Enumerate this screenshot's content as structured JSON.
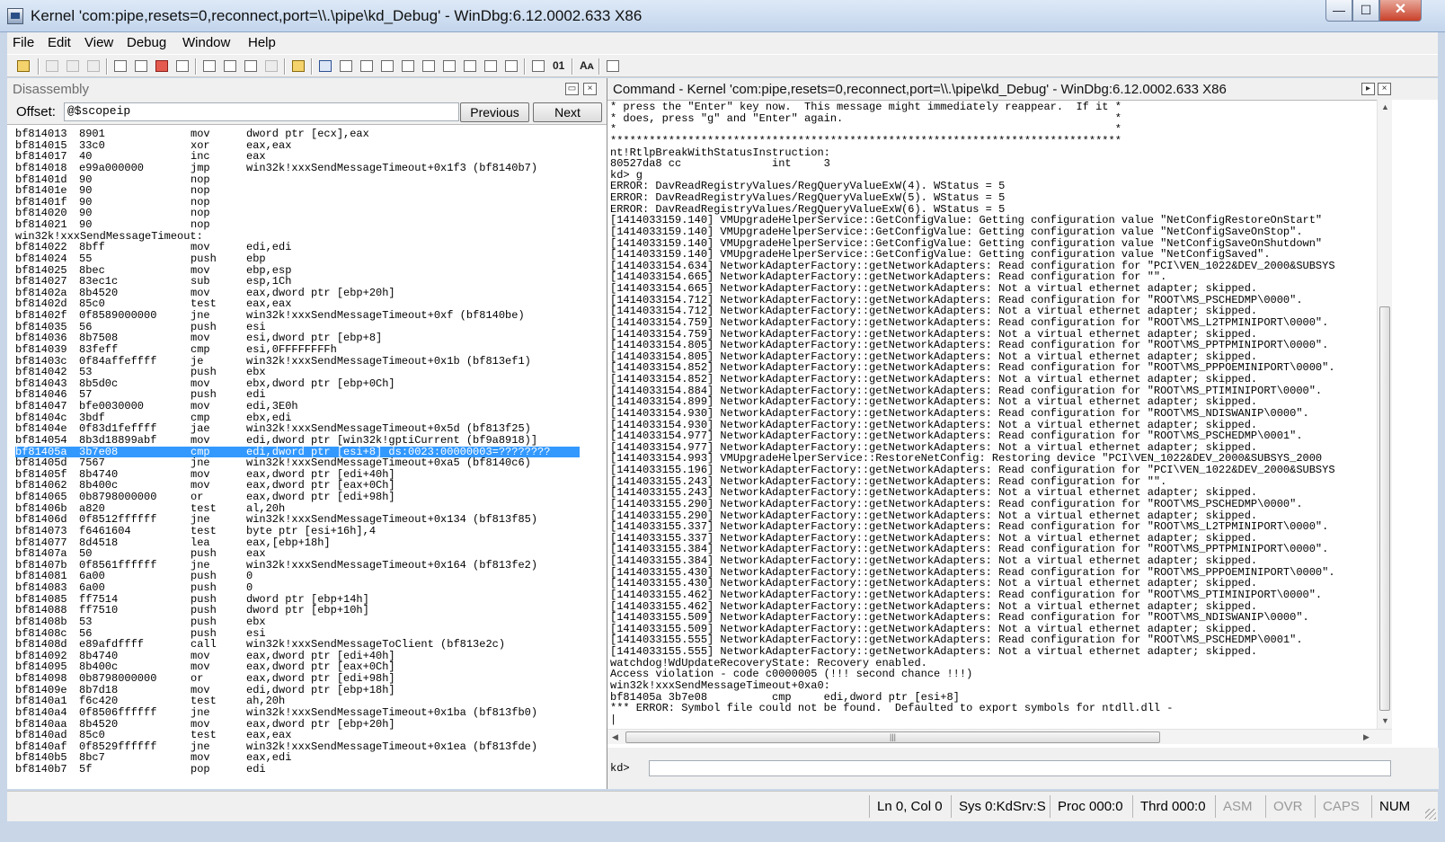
{
  "window": {
    "title": "Kernel 'com:pipe,resets=0,reconnect,port=\\\\.\\pipe\\kd_Debug' - WinDbg:6.12.0002.633 X86",
    "minimize": "—",
    "maximize": "☐",
    "close": "✕"
  },
  "menu": [
    "File",
    "Edit",
    "View",
    "Debug",
    "Window",
    "Help"
  ],
  "disassembly": {
    "title": "Disassembly",
    "offset_label": "Offset:",
    "offset_value": "@$scopeip",
    "prev_label": "Previous",
    "next_label": "Next",
    "rows": [
      [
        "bf814013",
        "8901",
        "mov",
        "dword ptr [ecx],eax"
      ],
      [
        "bf814015",
        "33c0",
        "xor",
        "eax,eax"
      ],
      [
        "bf814017",
        "40",
        "inc",
        "eax"
      ],
      [
        "bf814018",
        "e99a000000",
        "jmp",
        "win32k!xxxSendMessageTimeout+0x1f3 (bf8140b7)"
      ],
      [
        "bf81401d",
        "90",
        "nop",
        ""
      ],
      [
        "bf81401e",
        "90",
        "nop",
        ""
      ],
      [
        "bf81401f",
        "90",
        "nop",
        ""
      ],
      [
        "bf814020",
        "90",
        "nop",
        ""
      ],
      [
        "bf814021",
        "90",
        "nop",
        ""
      ],
      [
        "win32k!xxxSendMessageTimeout:"
      ],
      [
        "bf814022",
        "8bff",
        "mov",
        "edi,edi"
      ],
      [
        "bf814024",
        "55",
        "push",
        "ebp"
      ],
      [
        "bf814025",
        "8bec",
        "mov",
        "ebp,esp"
      ],
      [
        "bf814027",
        "83ec1c",
        "sub",
        "esp,1Ch"
      ],
      [
        "bf81402a",
        "8b4520",
        "mov",
        "eax,dword ptr [ebp+20h]"
      ],
      [
        "bf81402d",
        "85c0",
        "test",
        "eax,eax"
      ],
      [
        "bf81402f",
        "0f8589000000",
        "jne",
        "win32k!xxxSendMessageTimeout+0xf (bf8140be)"
      ],
      [
        "bf814035",
        "56",
        "push",
        "esi"
      ],
      [
        "bf814036",
        "8b7508",
        "mov",
        "esi,dword ptr [ebp+8]"
      ],
      [
        "bf814039",
        "83feff",
        "cmp",
        "esi,0FFFFFFFFh"
      ],
      [
        "bf81403c",
        "0f84affeffff",
        "je",
        "win32k!xxxSendMessageTimeout+0x1b (bf813ef1)"
      ],
      [
        "bf814042",
        "53",
        "push",
        "ebx"
      ],
      [
        "bf814043",
        "8b5d0c",
        "mov",
        "ebx,dword ptr [ebp+0Ch]"
      ],
      [
        "bf814046",
        "57",
        "push",
        "edi"
      ],
      [
        "bf814047",
        "bfe0030000",
        "mov",
        "edi,3E0h"
      ],
      [
        "bf81404c",
        "3bdf",
        "cmp",
        "ebx,edi"
      ],
      [
        "bf81404e",
        "0f83d1feffff",
        "jae",
        "win32k!xxxSendMessageTimeout+0x5d (bf813f25)"
      ],
      [
        "bf814054",
        "8b3d18899abf",
        "mov",
        "edi,dword ptr [win32k!gptiCurrent (bf9a8918)]"
      ],
      [
        "bf81405a",
        "3b7e08",
        "cmp",
        "edi,dword ptr [esi+8] ds:0023:00000003=????????"
      ],
      [
        "bf81405d",
        "7567",
        "jne",
        "win32k!xxxSendMessageTimeout+0xa5 (bf8140c6)"
      ],
      [
        "bf81405f",
        "8b4740",
        "mov",
        "eax,dword ptr [edi+40h]"
      ],
      [
        "bf814062",
        "8b400c",
        "mov",
        "eax,dword ptr [eax+0Ch]"
      ],
      [
        "bf814065",
        "0b8798000000",
        "or",
        "eax,dword ptr [edi+98h]"
      ],
      [
        "bf81406b",
        "a820",
        "test",
        "al,20h"
      ],
      [
        "bf81406d",
        "0f8512ffffff",
        "jne",
        "win32k!xxxSendMessageTimeout+0x134 (bf813f85)"
      ],
      [
        "bf814073",
        "f6461604",
        "test",
        "byte ptr [esi+16h],4"
      ],
      [
        "bf814077",
        "8d4518",
        "lea",
        "eax,[ebp+18h]"
      ],
      [
        "bf81407a",
        "50",
        "push",
        "eax"
      ],
      [
        "bf81407b",
        "0f8561ffffff",
        "jne",
        "win32k!xxxSendMessageTimeout+0x164 (bf813fe2)"
      ],
      [
        "bf814081",
        "6a00",
        "push",
        "0"
      ],
      [
        "bf814083",
        "6a00",
        "push",
        "0"
      ],
      [
        "bf814085",
        "ff7514",
        "push",
        "dword ptr [ebp+14h]"
      ],
      [
        "bf814088",
        "ff7510",
        "push",
        "dword ptr [ebp+10h]"
      ],
      [
        "bf81408b",
        "53",
        "push",
        "ebx"
      ],
      [
        "bf81408c",
        "56",
        "push",
        "esi"
      ],
      [
        "bf81408d",
        "e89afdffff",
        "call",
        "win32k!xxxSendMessageToClient (bf813e2c)"
      ],
      [
        "bf814092",
        "8b4740",
        "mov",
        "eax,dword ptr [edi+40h]"
      ],
      [
        "bf814095",
        "8b400c",
        "mov",
        "eax,dword ptr [eax+0Ch]"
      ],
      [
        "bf814098",
        "0b8798000000",
        "or",
        "eax,dword ptr [edi+98h]"
      ],
      [
        "bf81409e",
        "8b7d18",
        "mov",
        "edi,dword ptr [ebp+18h]"
      ],
      [
        "bf8140a1",
        "f6c420",
        "test",
        "ah,20h"
      ],
      [
        "bf8140a4",
        "0f8506ffffff",
        "jne",
        "win32k!xxxSendMessageTimeout+0x1ba (bf813fb0)"
      ],
      [
        "bf8140aa",
        "8b4520",
        "mov",
        "eax,dword ptr [ebp+20h]"
      ],
      [
        "bf8140ad",
        "85c0",
        "test",
        "eax,eax"
      ],
      [
        "bf8140af",
        "0f8529ffffff",
        "jne",
        "win32k!xxxSendMessageTimeout+0x1ea (bf813fde)"
      ],
      [
        "bf8140b5",
        "8bc7",
        "mov",
        "eax,edi"
      ],
      [
        "bf8140b7",
        "5f",
        "pop",
        "edi"
      ]
    ],
    "selected_row": 28
  },
  "command": {
    "title": "Command - Kernel 'com:pipe,resets=0,reconnect,port=\\\\.\\pipe\\kd_Debug' - WinDbg:6.12.0002.633 X86",
    "prompt": "kd>",
    "input_value": "",
    "output": [
      "* press the \"Enter\" key now.  This message might immediately reappear.  If it *",
      "* does, press \"g\" and \"Enter\" again.                                          *",
      "*                                                                             *",
      "*******************************************************************************",
      "nt!RtlpBreakWithStatusInstruction:",
      "80527da8 cc              int     3",
      "kd> g",
      "ERROR: DavReadRegistryValues/RegQueryValueExW(4). WStatus = 5",
      "ERROR: DavReadRegistryValues/RegQueryValueExW(5). WStatus = 5",
      "ERROR: DavReadRegistryValues/RegQueryValueExW(6). WStatus = 5",
      "[1414033159.140] VMUpgradeHelperService::GetConfigValue: Getting configuration value \"NetConfigRestoreOnStart\"",
      "[1414033159.140] VMUpgradeHelperService::GetConfigValue: Getting configuration value \"NetConfigSaveOnStop\".",
      "[1414033159.140] VMUpgradeHelperService::GetConfigValue: Getting configuration value \"NetConfigSaveOnShutdown\"",
      "[1414033159.140] VMUpgradeHelperService::GetConfigValue: Getting configuration value \"NetConfigSaved\".",
      "[1414033154.634] NetworkAdapterFactory::getNetworkAdapters: Read configuration for \"PCI\\VEN_1022&DEV_2000&SUBSYS",
      "[1414033154.665] NetworkAdapterFactory::getNetworkAdapters: Read configuration for \"\".",
      "[1414033154.665] NetworkAdapterFactory::getNetworkAdapters: Not a virtual ethernet adapter; skipped.",
      "[1414033154.712] NetworkAdapterFactory::getNetworkAdapters: Read configuration for \"ROOT\\MS_PSCHEDMP\\0000\".",
      "[1414033154.712] NetworkAdapterFactory::getNetworkAdapters: Not a virtual ethernet adapter; skipped.",
      "[1414033154.759] NetworkAdapterFactory::getNetworkAdapters: Read configuration for \"ROOT\\MS_L2TPMINIPORT\\0000\".",
      "[1414033154.759] NetworkAdapterFactory::getNetworkAdapters: Not a virtual ethernet adapter; skipped.",
      "[1414033154.805] NetworkAdapterFactory::getNetworkAdapters: Read configuration for \"ROOT\\MS_PPTPMINIPORT\\0000\".",
      "[1414033154.805] NetworkAdapterFactory::getNetworkAdapters: Not a virtual ethernet adapter; skipped.",
      "[1414033154.852] NetworkAdapterFactory::getNetworkAdapters: Read configuration for \"ROOT\\MS_PPPOEMINIPORT\\0000\".",
      "[1414033154.852] NetworkAdapterFactory::getNetworkAdapters: Not a virtual ethernet adapter; skipped.",
      "[1414033154.884] NetworkAdapterFactory::getNetworkAdapters: Read configuration for \"ROOT\\MS_PTIMINIPORT\\0000\".",
      "[1414033154.899] NetworkAdapterFactory::getNetworkAdapters: Not a virtual ethernet adapter; skipped.",
      "[1414033154.930] NetworkAdapterFactory::getNetworkAdapters: Read configuration for \"ROOT\\MS_NDISWANIP\\0000\".",
      "[1414033154.930] NetworkAdapterFactory::getNetworkAdapters: Not a virtual ethernet adapter; skipped.",
      "[1414033154.977] NetworkAdapterFactory::getNetworkAdapters: Read configuration for \"ROOT\\MS_PSCHEDMP\\0001\".",
      "[1414033154.977] NetworkAdapterFactory::getNetworkAdapters: Not a virtual ethernet adapter; skipped.",
      "[1414033154.993] VMUpgradeHelperService::RestoreNetConfig: Restoring device \"PCI\\VEN_1022&DEV_2000&SUBSYS_2000",
      "[1414033155.196] NetworkAdapterFactory::getNetworkAdapters: Read configuration for \"PCI\\VEN_1022&DEV_2000&SUBSYS",
      "[1414033155.243] NetworkAdapterFactory::getNetworkAdapters: Read configuration for \"\".",
      "[1414033155.243] NetworkAdapterFactory::getNetworkAdapters: Not a virtual ethernet adapter; skipped.",
      "[1414033155.290] NetworkAdapterFactory::getNetworkAdapters: Read configuration for \"ROOT\\MS_PSCHEDMP\\0000\".",
      "[1414033155.290] NetworkAdapterFactory::getNetworkAdapters: Not a virtual ethernet adapter; skipped.",
      "[1414033155.337] NetworkAdapterFactory::getNetworkAdapters: Read configuration for \"ROOT\\MS_L2TPMINIPORT\\0000\".",
      "[1414033155.337] NetworkAdapterFactory::getNetworkAdapters: Not a virtual ethernet adapter; skipped.",
      "[1414033155.384] NetworkAdapterFactory::getNetworkAdapters: Read configuration for \"ROOT\\MS_PPTPMINIPORT\\0000\".",
      "[1414033155.384] NetworkAdapterFactory::getNetworkAdapters: Not a virtual ethernet adapter; skipped.",
      "[1414033155.430] NetworkAdapterFactory::getNetworkAdapters: Read configuration for \"ROOT\\MS_PPPOEMINIPORT\\0000\".",
      "[1414033155.430] NetworkAdapterFactory::getNetworkAdapters: Not a virtual ethernet adapter; skipped.",
      "[1414033155.462] NetworkAdapterFactory::getNetworkAdapters: Read configuration for \"ROOT\\MS_PTIMINIPORT\\0000\".",
      "[1414033155.462] NetworkAdapterFactory::getNetworkAdapters: Not a virtual ethernet adapter; skipped.",
      "[1414033155.509] NetworkAdapterFactory::getNetworkAdapters: Read configuration for \"ROOT\\MS_NDISWANIP\\0000\".",
      "[1414033155.509] NetworkAdapterFactory::getNetworkAdapters: Not a virtual ethernet adapter; skipped.",
      "[1414033155.555] NetworkAdapterFactory::getNetworkAdapters: Read configuration for \"ROOT\\MS_PSCHEDMP\\0001\".",
      "[1414033155.555] NetworkAdapterFactory::getNetworkAdapters: Not a virtual ethernet adapter; skipped.",
      "watchdog!WdUpdateRecoveryState: Recovery enabled.",
      "Access violation - code c0000005 (!!! second chance !!!)",
      "win32k!xxxSendMessageTimeout+0xa0:",
      "bf81405a 3b7e08          cmp     edi,dword ptr [esi+8]",
      "*** ERROR: Symbol file could not be found.  Defaulted to export symbols for ntdll.dll -",
      "|"
    ]
  },
  "status": [
    "Ln 0, Col 0",
    "Sys 0:KdSrv:S",
    "Proc 000:0",
    "Thrd 000:0",
    "ASM",
    "OVR",
    "CAPS",
    "NUM"
  ],
  "status_active": [
    true,
    true,
    true,
    true,
    false,
    false,
    false,
    true
  ],
  "colors": {
    "selection": "#3399ff",
    "chrome": "#f0f0f0",
    "frame": "#c8d6e8"
  }
}
